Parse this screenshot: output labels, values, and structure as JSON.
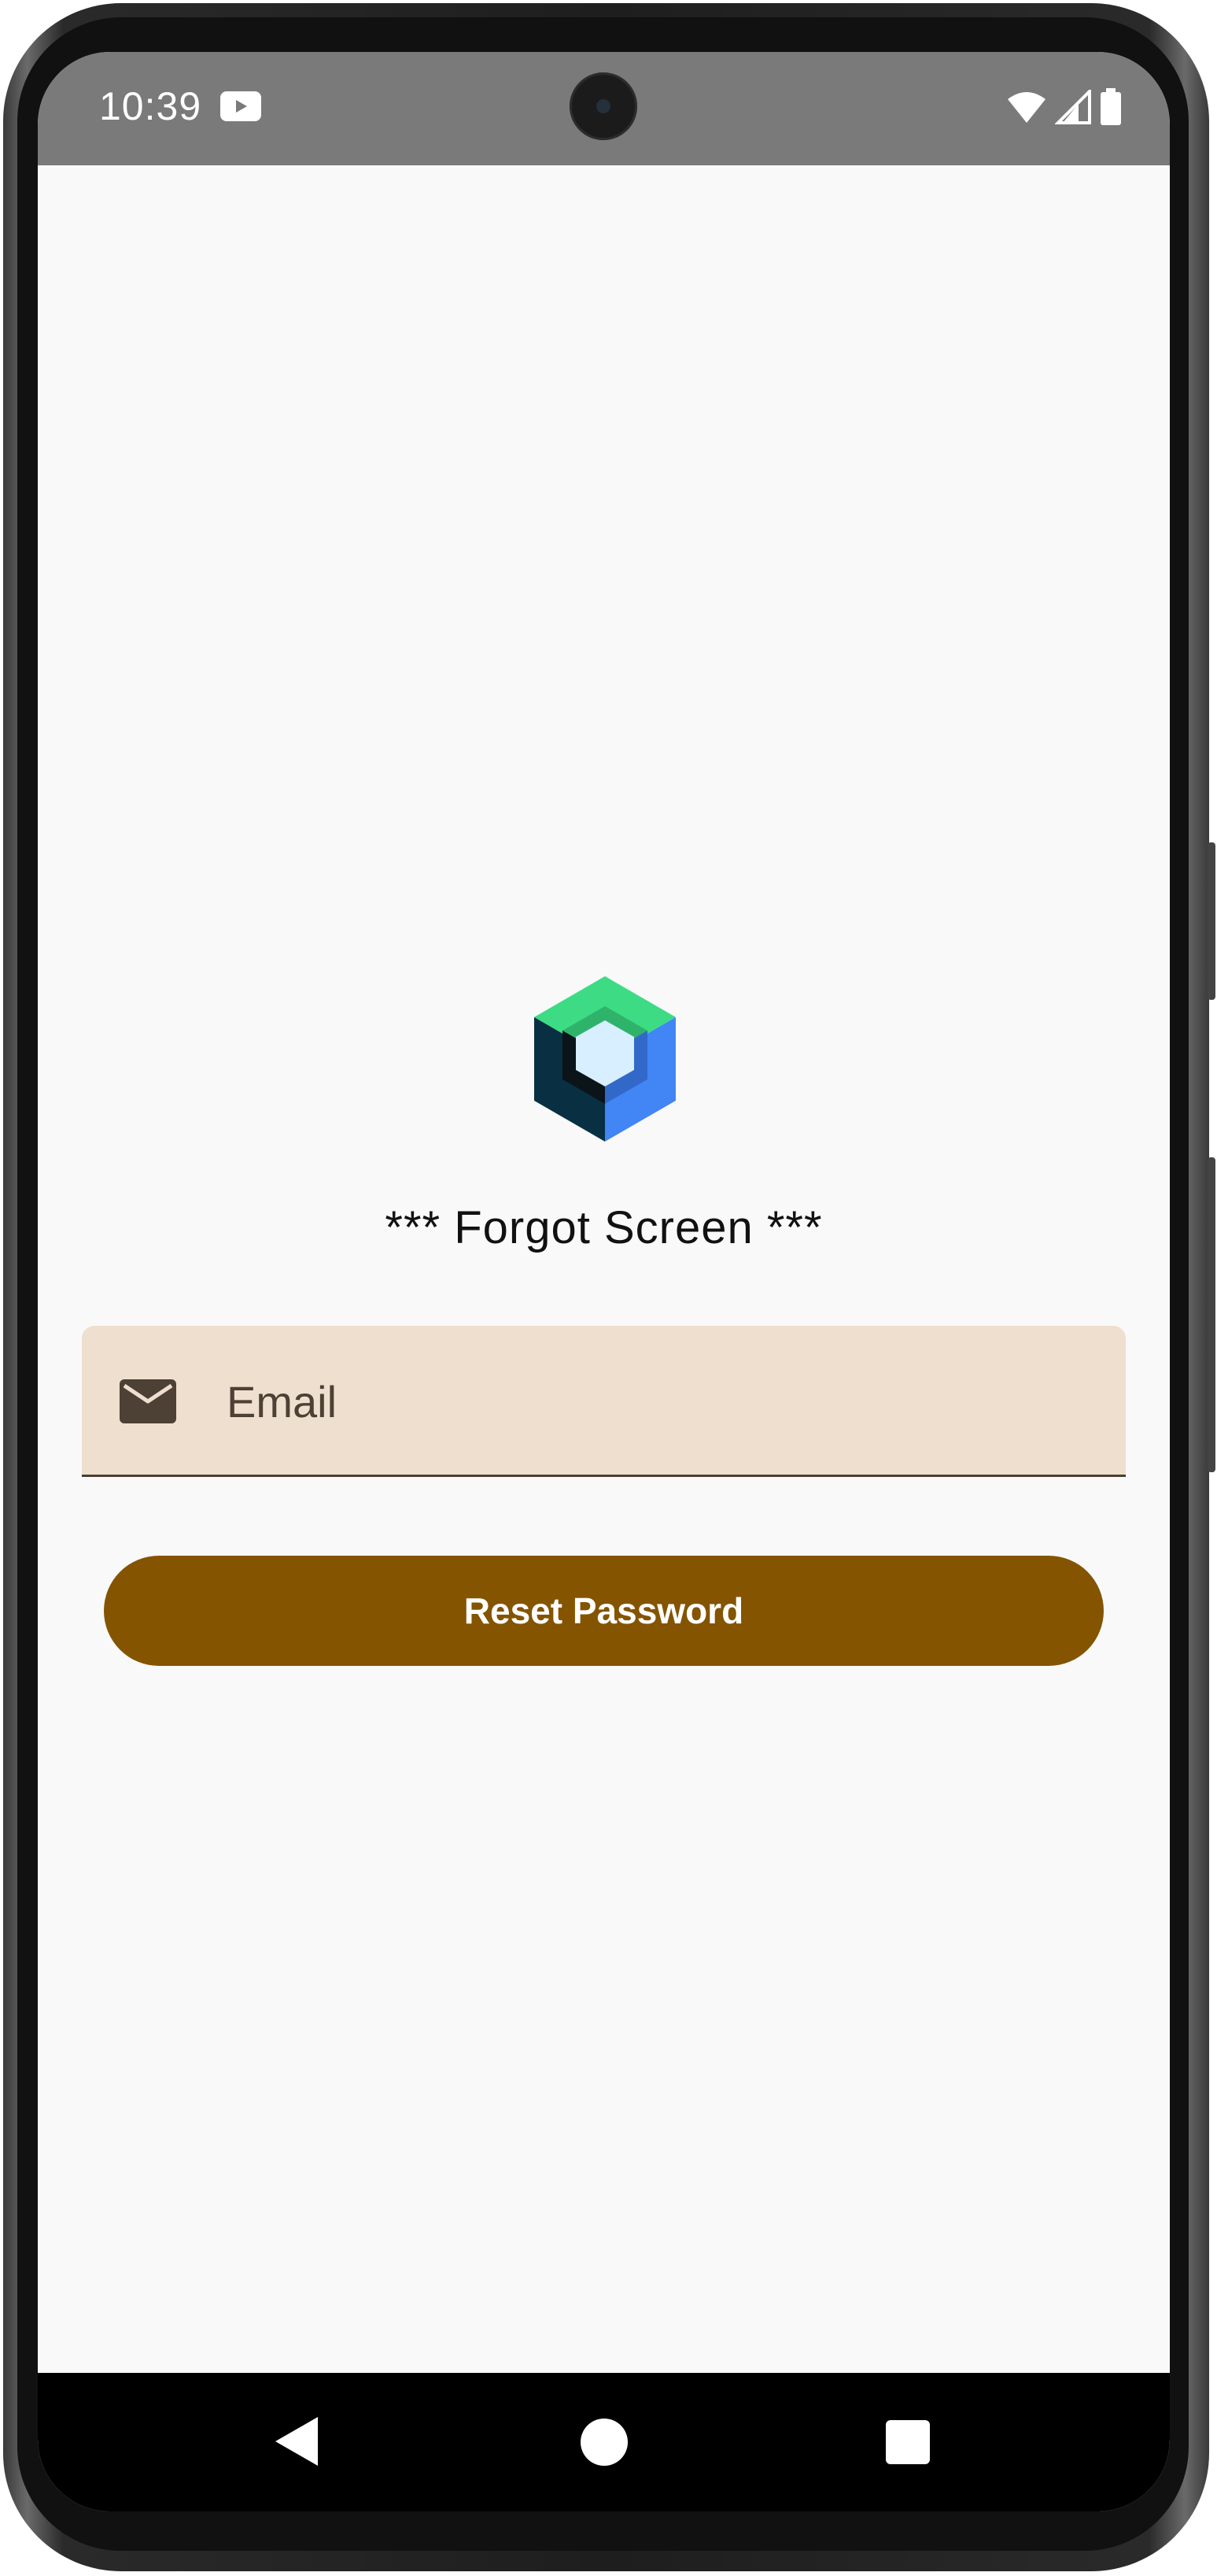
{
  "status_bar": {
    "time": "10:39",
    "icons": [
      "youtube-icon",
      "wifi-icon",
      "signal-icon",
      "battery-icon"
    ]
  },
  "screen": {
    "title": "*** Forgot Screen ***",
    "logo": "jetpack-compose-logo"
  },
  "email_field": {
    "placeholder": "Email",
    "value": "",
    "icon": "email-icon"
  },
  "reset_button": {
    "label": "Reset Password"
  },
  "nav_bar": {
    "items": [
      "back-icon",
      "home-icon",
      "recents-icon"
    ]
  },
  "colors": {
    "background": "#f9f9f9",
    "status_bar": "#7a7a7a",
    "field_background": "#efdfcf",
    "button": "#845400",
    "button_text": "#ffffff"
  }
}
